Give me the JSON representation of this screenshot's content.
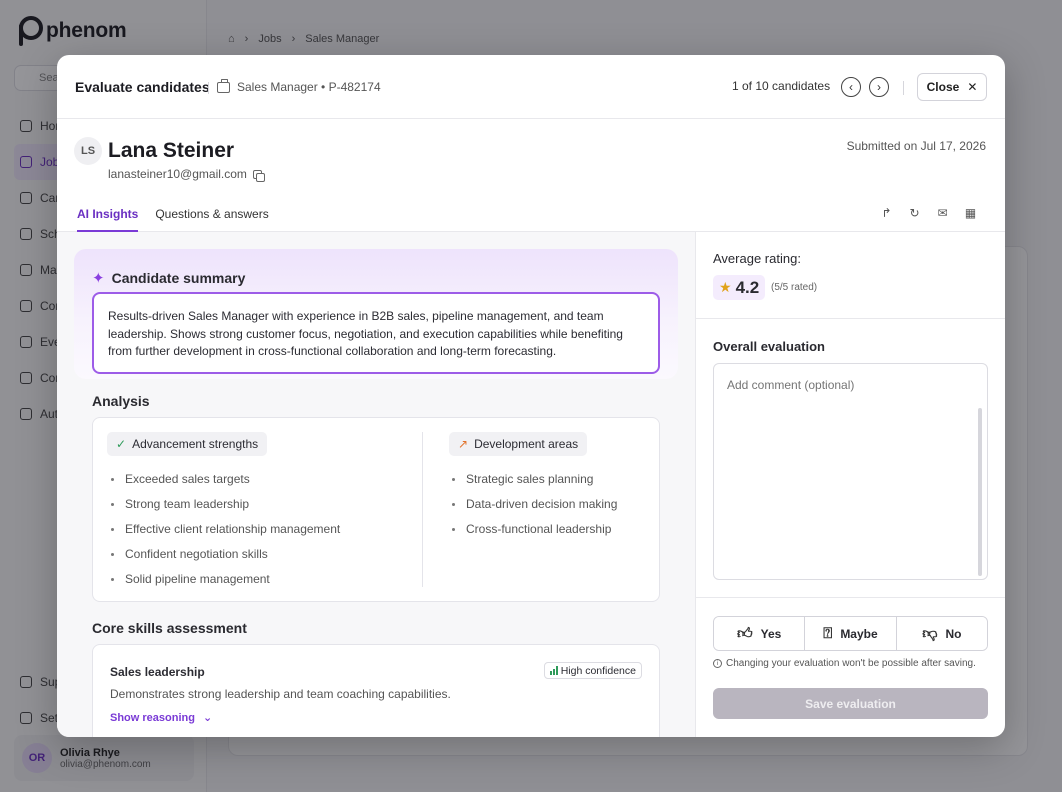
{
  "app": {
    "logo_text": "phenom",
    "search_placeholder": "Search",
    "nav": [
      "Home",
      "Jobs",
      "Candidates",
      "Schedule",
      "Marketing",
      "Communications",
      "Events",
      "Contacts",
      "Automations"
    ],
    "bottom_nav": [
      "Support",
      "Settings"
    ],
    "user": {
      "initials": "OR",
      "name": "Olivia Rhye",
      "email": "olivia@phenom.com"
    },
    "breadcrumb": [
      "Jobs",
      "Sales Manager"
    ]
  },
  "modal": {
    "title": "Evaluate candidates",
    "job": "Sales Manager • P-482174",
    "pager": "1 of 10 candidates",
    "close_label": "Close",
    "candidate": {
      "initials": "LS",
      "name": "Lana Steiner",
      "email": "lanasteiner10@gmail.com",
      "submitted": "Submitted on Jul 17, 2026"
    },
    "tabs": [
      "AI Insights",
      "Questions & answers"
    ],
    "summary": {
      "title": "Candidate summary",
      "text": "Results-driven Sales Manager with experience in B2B sales, pipeline management, and team leadership. Shows strong customer focus, negotiation, and execution capabilities while benefiting from further development in cross-functional collaboration and long-term forecasting."
    },
    "analysis": {
      "title": "Analysis",
      "strengths_title": "Advancement strengths",
      "strengths": [
        "Exceeded sales targets",
        "Strong team leadership",
        "Effective client relationship management",
        "Confident negotiation skills",
        "Solid pipeline management"
      ],
      "development_title": "Development areas",
      "development": [
        "Strategic sales planning",
        "Data-driven decision making",
        "Cross-functional leadership"
      ]
    },
    "core_skills": {
      "title": "Core skills assessment",
      "items": [
        {
          "name": "Sales leadership",
          "confidence": "High confidence",
          "description": "Demonstrates strong leadership and team coaching capabilities.",
          "reasoning_label": "Show reasoning"
        }
      ]
    },
    "rating": {
      "label": "Average rating:",
      "value": "4.2",
      "rated": "(5/5 rated)"
    },
    "evaluation": {
      "title": "Overall evaluation",
      "comment_placeholder": "Add comment (optional)",
      "options": [
        "Yes",
        "Maybe",
        "No"
      ],
      "note": "Changing your evaluation won't be possible after saving.",
      "save_label": "Save evaluation"
    }
  },
  "colors": {
    "accent": "#7a3ad6",
    "strength": "#2f9b5a",
    "development": "#e2732c",
    "star": "#e0a21a"
  }
}
